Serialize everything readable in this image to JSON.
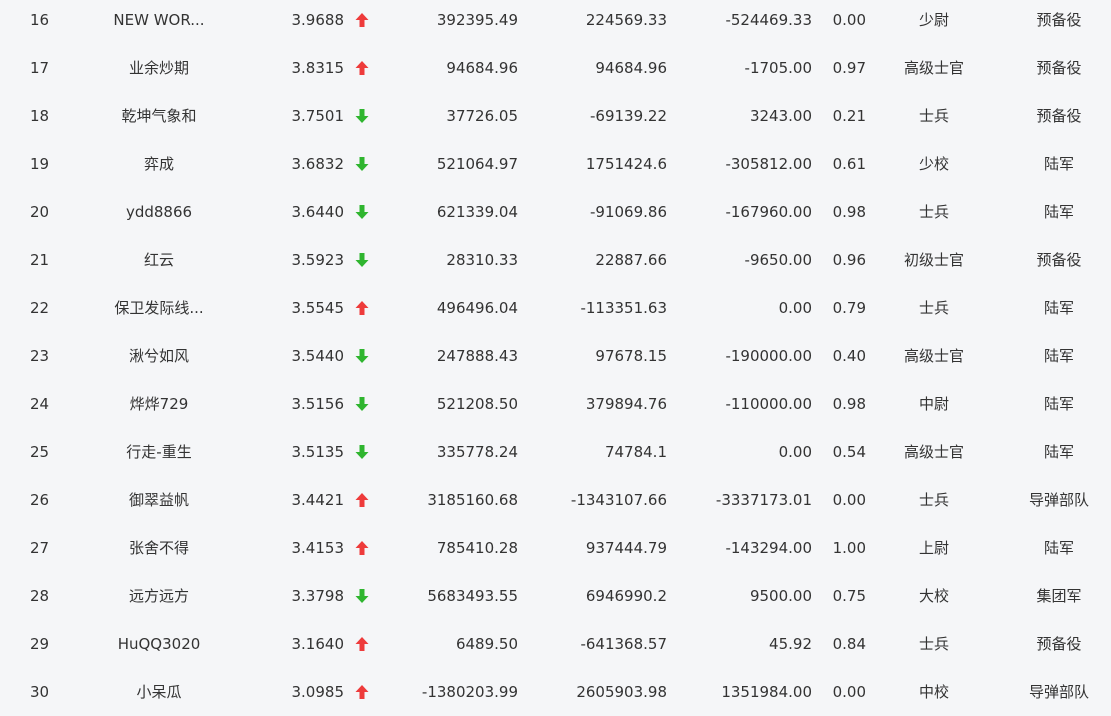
{
  "colors": {
    "up": "#ee3b3b",
    "down": "#2fb52f",
    "text": "#333333",
    "background": "#f5f6f8"
  },
  "rows": [
    {
      "rank": "16",
      "name": "NEW WOR...",
      "score": "3.9688",
      "trend": "up",
      "v1": "392395.49",
      "v2": "224569.33",
      "v3": "-524469.33",
      "ratio": "0.00",
      "title": "少尉",
      "branch": "预备役"
    },
    {
      "rank": "17",
      "name": "业余炒期",
      "score": "3.8315",
      "trend": "up",
      "v1": "94684.96",
      "v2": "94684.96",
      "v3": "-1705.00",
      "ratio": "0.97",
      "title": "高级士官",
      "branch": "预备役"
    },
    {
      "rank": "18",
      "name": "乾坤气象和",
      "score": "3.7501",
      "trend": "down",
      "v1": "37726.05",
      "v2": "-69139.22",
      "v3": "3243.00",
      "ratio": "0.21",
      "title": "士兵",
      "branch": "预备役"
    },
    {
      "rank": "19",
      "name": "弈成",
      "score": "3.6832",
      "trend": "down",
      "v1": "521064.97",
      "v2": "1751424.6",
      "v3": "-305812.00",
      "ratio": "0.61",
      "title": "少校",
      "branch": "陆军"
    },
    {
      "rank": "20",
      "name": "ydd8866",
      "score": "3.6440",
      "trend": "down",
      "v1": "621339.04",
      "v2": "-91069.86",
      "v3": "-167960.00",
      "ratio": "0.98",
      "title": "士兵",
      "branch": "陆军"
    },
    {
      "rank": "21",
      "name": "红云",
      "score": "3.5923",
      "trend": "down",
      "v1": "28310.33",
      "v2": "22887.66",
      "v3": "-9650.00",
      "ratio": "0.96",
      "title": "初级士官",
      "branch": "预备役"
    },
    {
      "rank": "22",
      "name": "保卫发际线...",
      "score": "3.5545",
      "trend": "up",
      "v1": "496496.04",
      "v2": "-113351.63",
      "v3": "0.00",
      "ratio": "0.79",
      "title": "士兵",
      "branch": "陆军"
    },
    {
      "rank": "23",
      "name": "湫兮如风",
      "score": "3.5440",
      "trend": "down",
      "v1": "247888.43",
      "v2": "97678.15",
      "v3": "-190000.00",
      "ratio": "0.40",
      "title": "高级士官",
      "branch": "陆军"
    },
    {
      "rank": "24",
      "name": "烨烨729",
      "score": "3.5156",
      "trend": "down",
      "v1": "521208.50",
      "v2": "379894.76",
      "v3": "-110000.00",
      "ratio": "0.98",
      "title": "中尉",
      "branch": "陆军"
    },
    {
      "rank": "25",
      "name": "行走-重生",
      "score": "3.5135",
      "trend": "down",
      "v1": "335778.24",
      "v2": "74784.1",
      "v3": "0.00",
      "ratio": "0.54",
      "title": "高级士官",
      "branch": "陆军"
    },
    {
      "rank": "26",
      "name": "御翠益帆",
      "score": "3.4421",
      "trend": "up",
      "v1": "3185160.68",
      "v2": "-1343107.66",
      "v3": "-3337173.01",
      "ratio": "0.00",
      "title": "士兵",
      "branch": "导弹部队"
    },
    {
      "rank": "27",
      "name": "张舍不得",
      "score": "3.4153",
      "trend": "up",
      "v1": "785410.28",
      "v2": "937444.79",
      "v3": "-143294.00",
      "ratio": "1.00",
      "title": "上尉",
      "branch": "陆军"
    },
    {
      "rank": "28",
      "name": "远方远方",
      "score": "3.3798",
      "trend": "down",
      "v1": "5683493.55",
      "v2": "6946990.2",
      "v3": "9500.00",
      "ratio": "0.75",
      "title": "大校",
      "branch": "集团军"
    },
    {
      "rank": "29",
      "name": "HuQQ3020",
      "score": "3.1640",
      "trend": "up",
      "v1": "6489.50",
      "v2": "-641368.57",
      "v3": "45.92",
      "ratio": "0.84",
      "title": "士兵",
      "branch": "预备役"
    },
    {
      "rank": "30",
      "name": "小呆瓜",
      "score": "3.0985",
      "trend": "up",
      "v1": "-1380203.99",
      "v2": "2605903.98",
      "v3": "1351984.00",
      "ratio": "0.00",
      "title": "中校",
      "branch": "导弹部队"
    }
  ]
}
